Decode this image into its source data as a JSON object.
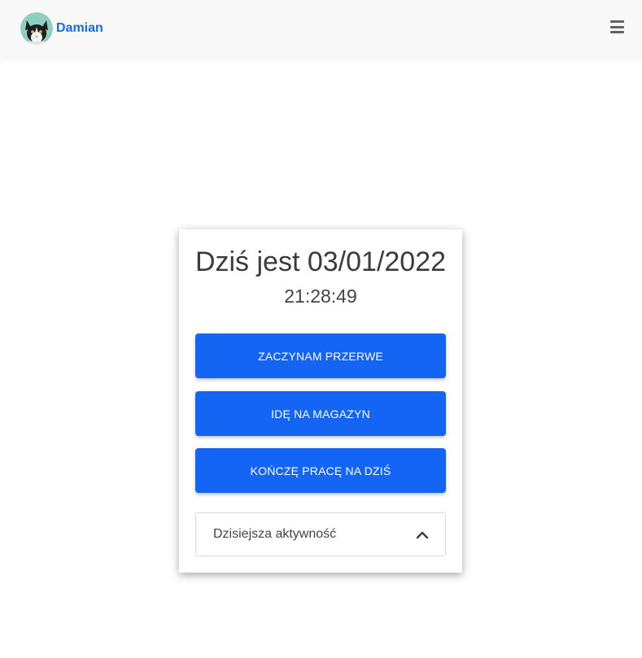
{
  "navbar": {
    "user_name": "Damian",
    "avatar_icon": "cat-avatar-icon",
    "menu_icon": "hamburger-menu-icon"
  },
  "card": {
    "date_title": "Dziś jest 03/01/2022",
    "time": "21:28:49",
    "buttons": [
      {
        "label": "ZACZYNAM PRZERWE"
      },
      {
        "label": "IDĘ NA MAGAZYN"
      },
      {
        "label": "KOŃCZĘ PRACĘ NA DZIŚ"
      }
    ],
    "accordion": {
      "label": "Dzisiejsza aktywność",
      "icon": "chevron-up-icon"
    }
  },
  "colors": {
    "primary": "#1565f5",
    "brand_text": "#1a6bd8",
    "navbar_bg": "#f8f8f8"
  }
}
